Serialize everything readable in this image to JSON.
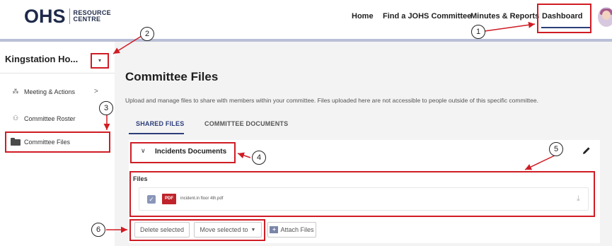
{
  "logo": {
    "main": "OHS",
    "sub_line1": "RESOURCE",
    "sub_line2": "CENTRE"
  },
  "nav": {
    "items": [
      "Home",
      "Find a JOHS Committee",
      "Minutes & Reports",
      "Dashboard"
    ]
  },
  "sidebar": {
    "team_name": "Kingstation Ho...",
    "dropdown_glyph": "▾",
    "items": [
      {
        "label": "Meeting & Actions",
        "icon": "meeting-icon",
        "chevron": ">"
      },
      {
        "label": "Committee Roster",
        "icon": "roster-icon"
      },
      {
        "label": "Committee Files",
        "icon": "folder-icon"
      }
    ]
  },
  "main": {
    "title": "Committee Files",
    "description": "Upload and manage files to share with members within your committee. Files uploaded here are not accessible to people outside of this specific committee.",
    "tabs": [
      "SHARED FILES",
      "COMMITTEE DOCUMENTS"
    ],
    "active_tab": "SHARED FILES",
    "section": {
      "chevron": "∨",
      "title": "Incidents Documents",
      "files_label": "Files",
      "files": [
        {
          "name": "incident.in floor 4th.pdf",
          "type": "PDF",
          "checked": true
        }
      ]
    },
    "actions": {
      "delete": "Delete selected",
      "move": "Move selected to",
      "attach": "Attach Files"
    }
  },
  "annotations": {
    "numbers": [
      "1",
      "2",
      "3",
      "4",
      "5",
      "6"
    ],
    "color": "#d01c24"
  }
}
